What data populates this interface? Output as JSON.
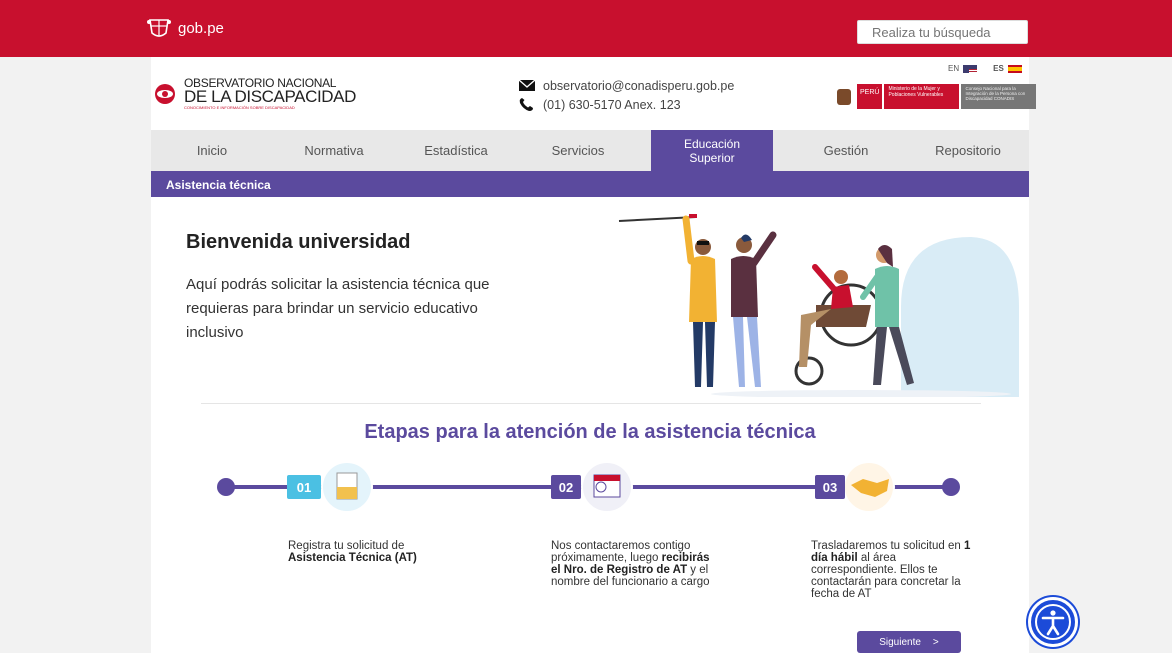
{
  "topbar": {
    "brand": "gob.pe",
    "search_placeholder": "Realiza tu búsqueda"
  },
  "header": {
    "logo_line1": "OBSERVATORIO NACIONAL",
    "logo_line2": "DE LA DISCAPACIDAD",
    "logo_tagline": "CONOCIMIENTO E INFORMACIÓN SOBRE DISCAPACIDAD",
    "email": "observatorio@conadisperu.gob.pe",
    "phone": "(01) 630-5170 Anex. 123",
    "lang_en": "EN",
    "lang_es": "ES",
    "gov_peru": "PERÚ",
    "gov_ministry": "Ministerio de la Mujer y Poblaciones Vulnerables",
    "gov_council": "Consejo Nacional para la Integración de la Persona con Discapacidad CONADIS"
  },
  "nav": {
    "items": [
      "Inicio",
      "Normativa",
      "Estadística",
      "Servicios",
      "Educación Superior",
      "Gestión",
      "Repositorio"
    ],
    "active_index": 4
  },
  "subbar": {
    "label": "Asistencia técnica"
  },
  "hero": {
    "title": "Bienvenida universidad",
    "text": "Aquí podrás solicitar la asistencia técnica que requieras para brindar un servicio educativo inclusivo"
  },
  "stages": {
    "title": "Etapas para la atención de la  asistencia técnica",
    "steps": [
      {
        "num": "01",
        "desc_a": "Registra tu solicitud de ",
        "desc_b": "Asistencia Técnica (AT)",
        "desc_c": "",
        "desc_d": "",
        "desc_e": ""
      },
      {
        "num": "02",
        "desc_a": "Nos contactaremos contigo próximamente, luego ",
        "desc_b": "recibirás el Nro. de Registro de AT",
        "desc_c": " y el nombre del funcionario a cargo",
        "desc_d": "",
        "desc_e": ""
      },
      {
        "num": "03",
        "desc_a": "Trasladaremos tu solicitud en ",
        "desc_b": "1 día hábil",
        "desc_c": " al área correspondiente. Ellos te contactarán para concretar la fecha de AT",
        "desc_d": "",
        "desc_e": ""
      }
    ],
    "next_label": "Siguiente",
    "next_arrow": ">"
  },
  "colors": {
    "brand_red": "#c8102e",
    "brand_purple": "#5b4a9e",
    "accessibility_blue": "#1c4bd8"
  }
}
